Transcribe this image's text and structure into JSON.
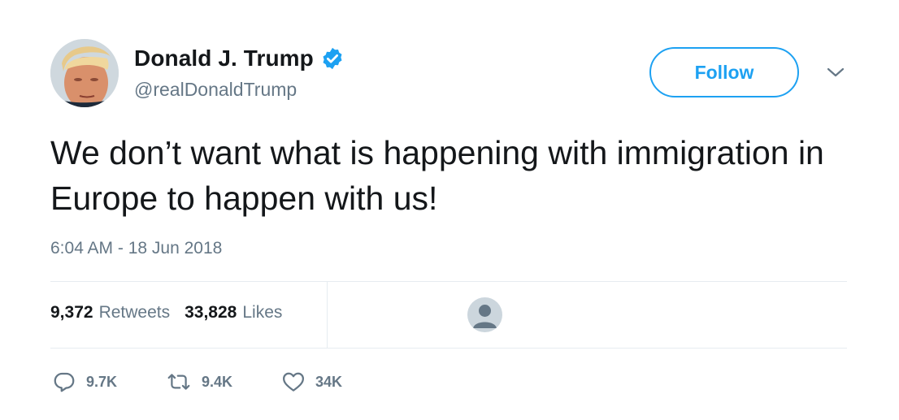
{
  "author": {
    "name": "Donald J. Trump",
    "handle": "@realDonaldTrump",
    "verified": true,
    "avatar_icon": "profile-photo"
  },
  "follow_label": "Follow",
  "tweet": {
    "text": "We don’t want what is happening with immigration in Europe to happen with us!",
    "timestamp": "6:04 AM - 18 Jun 2018"
  },
  "stats": {
    "retweets_count": "9,372",
    "retweets_label": "Retweets",
    "likes_count": "33,828",
    "likes_label": "Likes"
  },
  "actions": {
    "reply_count": "9.7K",
    "retweet_count": "9.4K",
    "like_count": "34K"
  },
  "colors": {
    "accent": "#1da1f2",
    "text": "#14171a",
    "secondary": "#657786",
    "divider": "#e6ecf0"
  }
}
